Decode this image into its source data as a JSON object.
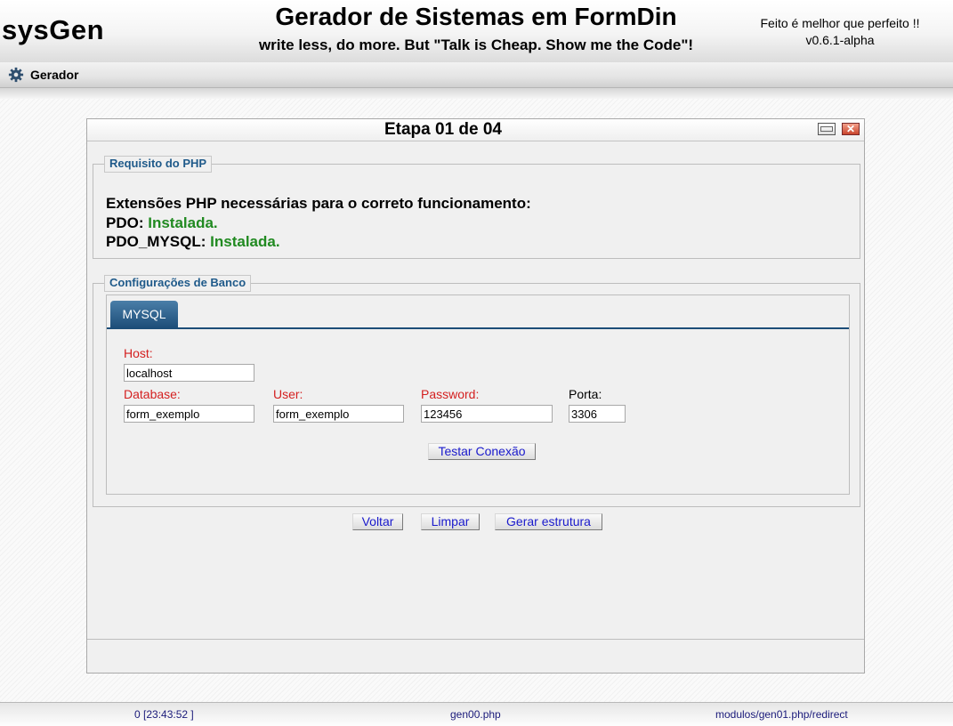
{
  "header": {
    "logo": "sysGen",
    "title": "Gerador de Sistemas em FormDin",
    "subtitle": "write less, do more. But \"Talk is Cheap. Show me the Code\"!",
    "motto": "Feito é melhor que perfeito !!",
    "version": "v0.6.1-alpha"
  },
  "menu": {
    "items": [
      {
        "label": "Gerador",
        "icon": "gear-icon"
      }
    ]
  },
  "window": {
    "title": "Etapa 01 de 04",
    "php_requirements": {
      "legend": "Requisito do PHP",
      "heading": "Extensões PHP necessárias para o correto funcionamento:",
      "extensions": [
        {
          "name": "PDO",
          "status": "Instalada."
        },
        {
          "name": "PDO_MYSQL",
          "status": "Instalada."
        }
      ]
    },
    "database": {
      "legend": "Configurações de Banco",
      "tab": "MYSQL",
      "fields": {
        "host": {
          "label": "Host:",
          "value": "localhost"
        },
        "database": {
          "label": "Database:",
          "value": "form_exemplo"
        },
        "user": {
          "label": "User:",
          "value": "form_exemplo"
        },
        "password": {
          "label": "Password:",
          "value": "123456"
        },
        "port": {
          "label": "Porta:",
          "value": "3306"
        }
      },
      "test_button": "Testar Conexão"
    },
    "actions": {
      "back": "Voltar",
      "clear": "Limpar",
      "generate": "Gerar estrutura"
    }
  },
  "status": {
    "left": "0 [23:43:52 ]",
    "center": "gen00.php",
    "right": "modulos/gen01.php/redirect"
  },
  "colors": {
    "required_label": "#d42020",
    "installed": "#218a21",
    "tab": "#1c4d78",
    "legend": "#1f5a8a"
  }
}
